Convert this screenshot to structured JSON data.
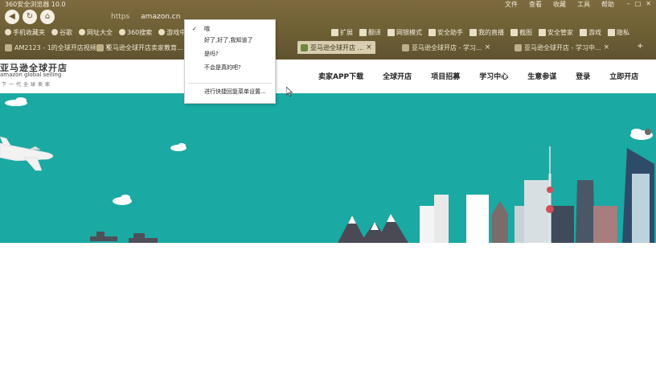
{
  "browser": {
    "app_title": "360安全浏览器 10.0",
    "title_menu": [
      "文件",
      "查看",
      "收藏",
      "工具",
      "帮助"
    ],
    "url_proto": "https",
    "url": "amazon.cn"
  },
  "bookmarks": {
    "left": [
      "手机收藏夹",
      "谷歌",
      "网址大全",
      "360搜索",
      "游戏中心"
    ],
    "right": [
      "扩展",
      "翻译",
      "网银模式",
      "安全助手",
      "我的直播",
      "截图",
      "安全管家",
      "游戏",
      "隐私"
    ]
  },
  "tabs": [
    {
      "label": "AM2123 - 1的全球开店视频..."
    },
    {
      "label": "亚马逊全球开店卖家教育..."
    },
    {
      "label": "亚马逊全球开店 ..."
    },
    {
      "label": "亚马逊全球开店 - 学习..."
    },
    {
      "label": "亚马逊全球开店 - 学习中..."
    }
  ],
  "context_menu": {
    "items": [
      {
        "check": "✓",
        "label": "哦"
      },
      {
        "check": "",
        "label": "好了,好了,我知道了"
      },
      {
        "check": "",
        "label": "是吗?"
      },
      {
        "check": "",
        "label": "不会是真的吧?"
      }
    ],
    "settings": "进行快捷回复菜单设置..."
  },
  "site": {
    "logo_cn": "亚马逊全球开店",
    "logo_en": "amazon global selling",
    "logo_tag": "下一代全球卖家",
    "nav": [
      "卖家APP下载",
      "全球开店",
      "项目招募",
      "学习中心",
      "生意参谋",
      "登录",
      "立即开店"
    ]
  },
  "colors": {
    "chrome": "#6f6035",
    "hero": "#1aa9a3",
    "menu_bg": "#ffffff"
  }
}
